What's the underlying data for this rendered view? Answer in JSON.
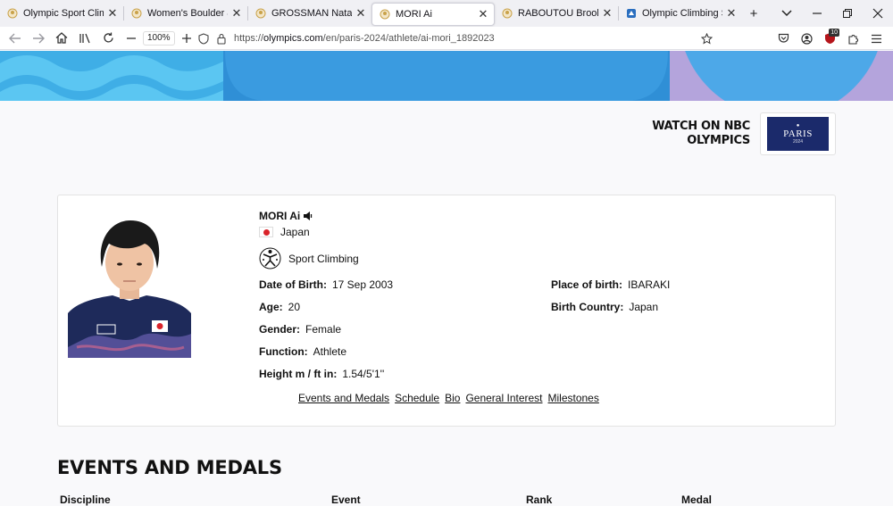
{
  "tabs": [
    {
      "title": "Olympic Sport Climbing",
      "icon": "olympics-ring-icon"
    },
    {
      "title": "Women's Boulder & Lead",
      "icon": "olympics-ring-icon"
    },
    {
      "title": "GROSSMAN Natalia",
      "icon": "olympics-ring-icon"
    },
    {
      "title": "MORI Ai",
      "icon": "olympics-ring-icon",
      "active": true
    },
    {
      "title": "RABOUTOU Brooke",
      "icon": "olympics-ring-icon"
    },
    {
      "title": "Olympic Climbing SPOR",
      "icon": "site-icon"
    }
  ],
  "toolbar": {
    "zoom": "100%",
    "url_prefix": "https://",
    "url_host": "olympics.com",
    "url_path": "/en/paris-2024/athlete/ai-mori_1892023",
    "extension_badge": "10"
  },
  "promo": {
    "watch_line1": "WATCH ON NBC",
    "watch_line2": "OLYMPICS",
    "logo_text": "PARIS",
    "logo_year": "2024"
  },
  "athlete": {
    "name": "MORI Ai",
    "country": "Japan",
    "sport": "Sport Climbing",
    "fields": {
      "dob_label": "Date of Birth:",
      "dob": "17 Sep 2003",
      "age_label": "Age:",
      "age": "20",
      "gender_label": "Gender:",
      "gender": "Female",
      "function_label": "Function:",
      "function": "Athlete",
      "height_label": "Height m / ft in:",
      "height": "1.54/5'1''",
      "pob_label": "Place of birth:",
      "pob": "IBARAKI",
      "birth_country_label": "Birth Country:",
      "birth_country": "Japan"
    },
    "links": [
      "Events and Medals",
      "Schedule",
      "Bio",
      "General Interest",
      "Milestones"
    ]
  },
  "section": {
    "title": "EVENTS AND MEDALS",
    "columns": [
      "Discipline",
      "Event",
      "Rank",
      "Medal"
    ]
  },
  "colors": {
    "banner_wave": "#5bc6f2",
    "banner_dark": "#2f8fd6",
    "banner_lavender": "#b4a4dc",
    "japan_red": "#d9232a"
  }
}
